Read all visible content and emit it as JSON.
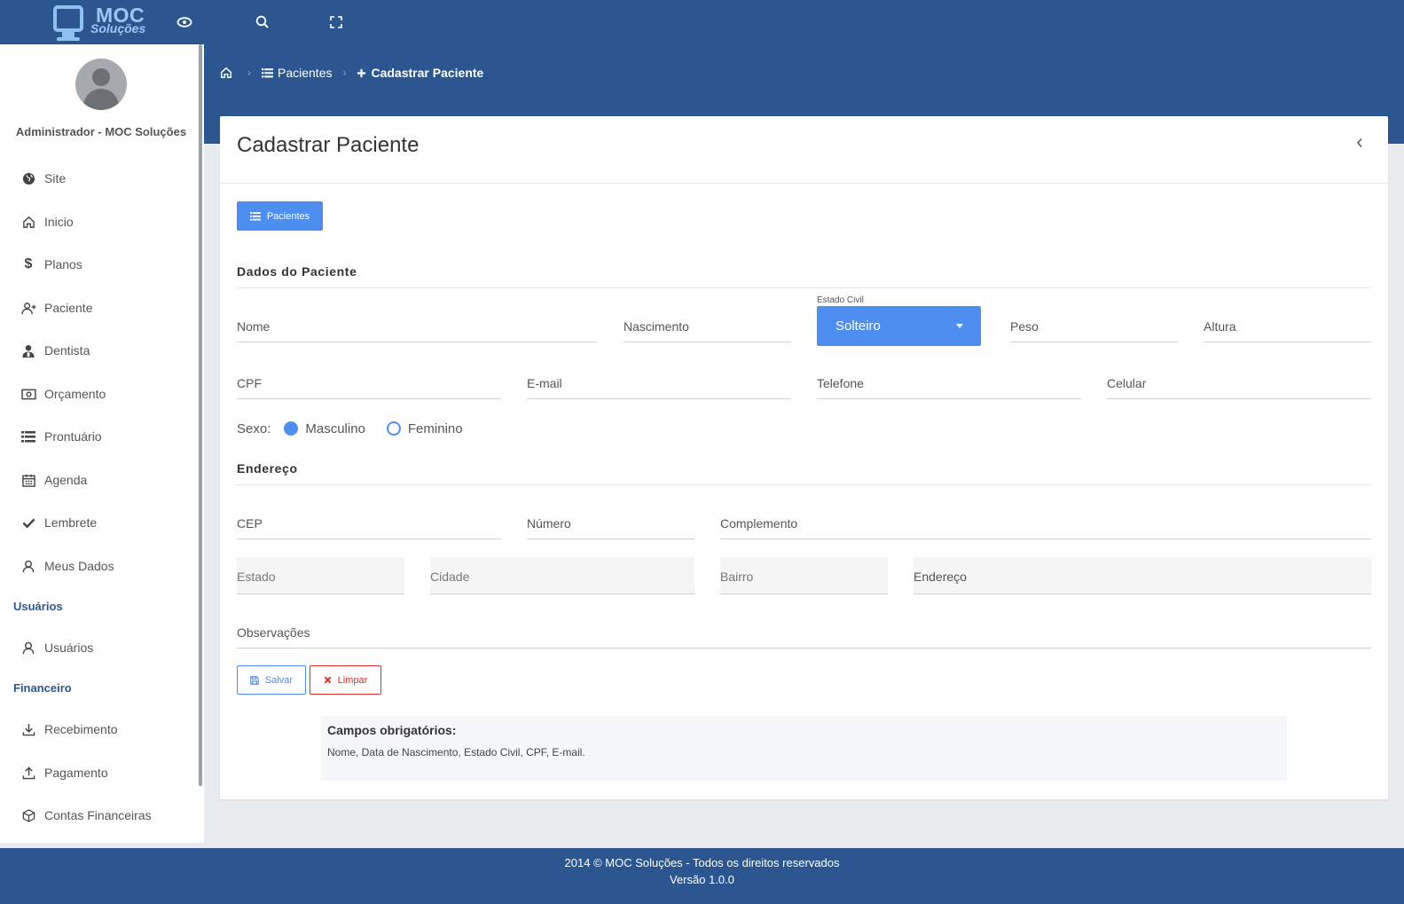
{
  "brand": {
    "name": "MOC",
    "sub": "Soluções"
  },
  "topbar": {
    "icons": [
      "eye-icon",
      "search-icon",
      "fullscreen-icon"
    ]
  },
  "user": {
    "name": "Administrador - MOC Soluções"
  },
  "sidebar": {
    "items": [
      {
        "label": "Site",
        "icon": "globe-icon"
      },
      {
        "label": "Inicio",
        "icon": "home-icon"
      },
      {
        "label": "Planos",
        "icon": "dollar-icon"
      },
      {
        "label": "Paciente",
        "icon": "user-plus-icon"
      },
      {
        "label": "Dentista",
        "icon": "user-doctor-icon"
      },
      {
        "label": "Orçamento",
        "icon": "money-bill-icon"
      },
      {
        "label": "Prontuário",
        "icon": "list-icon"
      },
      {
        "label": "Agenda",
        "icon": "calendar-icon"
      },
      {
        "label": "Lembrete",
        "icon": "check-icon"
      },
      {
        "label": "Meus Dados",
        "icon": "user-icon"
      }
    ],
    "sections": [
      {
        "title": "Usuários",
        "items": [
          {
            "label": "Usuários",
            "icon": "user-icon"
          }
        ]
      },
      {
        "title": "Financeiro",
        "items": [
          {
            "label": "Recebimento",
            "icon": "download-icon"
          },
          {
            "label": "Pagamento",
            "icon": "upload-icon"
          },
          {
            "label": "Contas Financeiras",
            "icon": "box-icon"
          }
        ]
      }
    ]
  },
  "breadcrumb": {
    "home_icon": "home-icon",
    "items": [
      "Pacientes",
      "Cadastrar Paciente"
    ]
  },
  "card": {
    "title": "Cadastrar Paciente",
    "list_button": "Pacientes"
  },
  "form": {
    "section_patient": "Dados do Paciente",
    "fields": {
      "nome": "Nome",
      "nascimento": "Nascimento",
      "estado_civil_label": "Estado Civil",
      "estado_civil_value": "Solteiro",
      "peso": "Peso",
      "altura": "Altura",
      "cpf": "CPF",
      "email": "E-mail",
      "telefone": "Telefone",
      "celular": "Celular"
    },
    "sexo": {
      "label": "Sexo:",
      "options": [
        "Masculino",
        "Feminino"
      ],
      "selected": "Masculino"
    },
    "section_address": "Endereço",
    "address": {
      "cep": "CEP",
      "numero": "Número",
      "complemento": "Complemento",
      "estado": "Estado",
      "cidade": "Cidade",
      "bairro": "Bairro",
      "endereco": "Endereço"
    },
    "observacoes": "Observações",
    "save_label": "Salvar",
    "clear_label": "Limpar"
  },
  "notice": {
    "title": "Campos obrigatórios:",
    "text": "Nome, Data de Nascimento, Estado Civil, CPF, E-mail."
  },
  "footer": {
    "line1": "2014 © MOC Soluções - Todos os direitos reservados",
    "line2": "Versão 1.0.0"
  },
  "colors": {
    "primary": "#2b5690",
    "accent": "#4d8ef0",
    "danger": "#d93025"
  }
}
